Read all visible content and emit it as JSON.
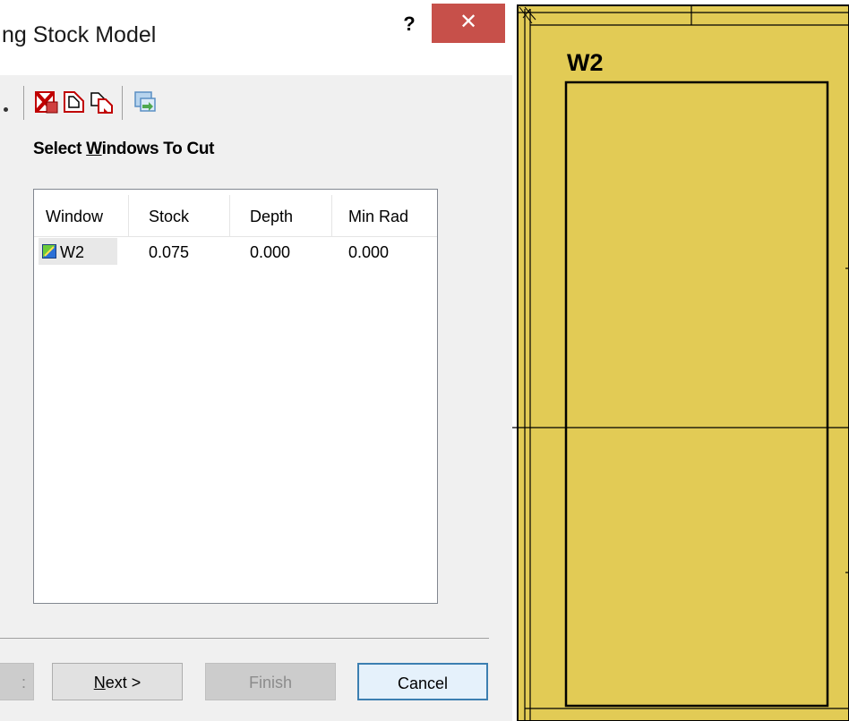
{
  "dialog": {
    "title": "ng Stock Model",
    "help_label": "?",
    "close_label": "✕",
    "toolbar": {
      "icons": [
        "delete-red-icon",
        "shape-outline-icon",
        "copy-shape-icon",
        "import-icon"
      ]
    },
    "section_prefix": "Select ",
    "section_underlined": "W",
    "section_suffix": "indows To Cut",
    "table": {
      "columns": [
        "Window",
        "Stock",
        "Depth",
        "Min Rad"
      ],
      "rows": [
        {
          "window": "W2",
          "stock": "0.075",
          "depth": "0.000",
          "min_rad": "0.000"
        }
      ]
    },
    "buttons": {
      "back_partial": ":",
      "next_underlined": "N",
      "next_rest": "ext >",
      "finish": "Finish",
      "cancel": "Cancel"
    }
  },
  "viewport": {
    "label": "W2",
    "fill_color": "#e2cb55"
  }
}
